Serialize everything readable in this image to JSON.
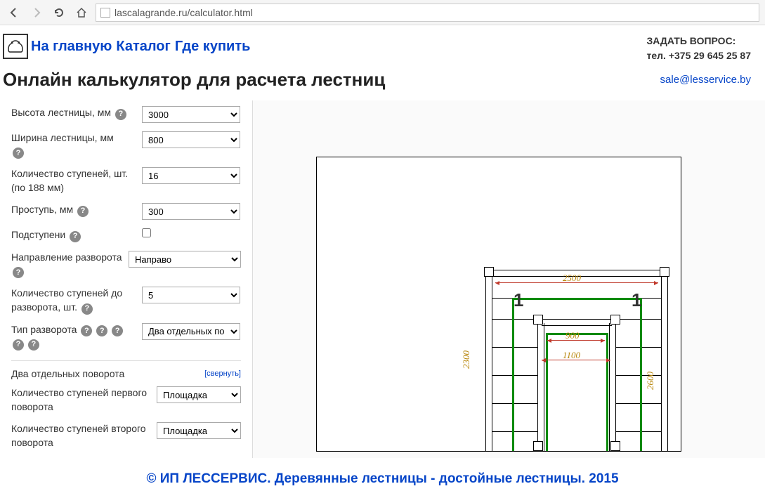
{
  "browser": {
    "url": "lascalagrande.ru/calculator.html"
  },
  "nav": {
    "home": "На главную",
    "catalog": "Каталог",
    "where": "Где купить"
  },
  "contact": {
    "ask": "ЗАДАТЬ ВОПРОС:",
    "phone": "тел. +375 29 645 25 87",
    "email": "sale@lesservice.by"
  },
  "title": "Онлайн калькулятор для расчета лестниц",
  "form": {
    "height_label": "Высота лестницы, мм",
    "height_value": "3000",
    "width_label": "Ширина лестницы, мм",
    "width_value": "800",
    "steps_label": "Количество ступеней, шт. (по 188 мм)",
    "steps_value": "16",
    "tread_label": "Проступь, мм",
    "tread_value": "300",
    "riser_label": "Подступени",
    "direction_label": "Направление разворота",
    "direction_value": "Направо",
    "before_turn_label": "Количество ступеней до разворота, шт.",
    "before_turn_value": "5",
    "turn_type_label": "Тип разворота",
    "turn_type_value": "Два отдельных по",
    "section_title": "Два отдельных поворота",
    "collapse": "[свернуть]",
    "first_turn_label": "Количество ступеней первого поворота",
    "first_turn_value": "Площадка",
    "second_turn_label": "Количество ступеней второго поворота",
    "second_turn_value": "Площадка"
  },
  "drawing": {
    "dim_2500": "2500",
    "dim_900": "900",
    "dim_1100": "1100",
    "dim_2300": "2300",
    "dim_2600": "2600",
    "marker": "1"
  },
  "footer": "© ИП ЛЕССЕРВИС. Деревянные лестницы - достойные лестницы. 2015"
}
